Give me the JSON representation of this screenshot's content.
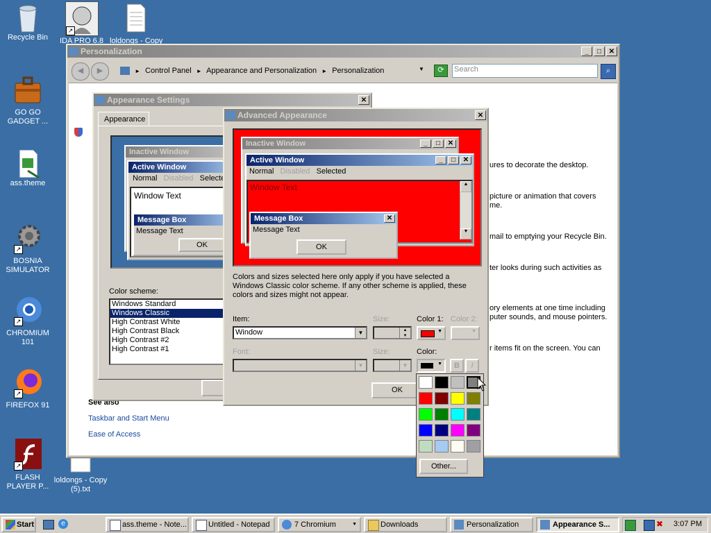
{
  "desktop": {
    "icons": [
      {
        "label": "Recycle Bin"
      },
      {
        "label": "IDA PRO 6.8"
      },
      {
        "label": "loldongs - Copy"
      },
      {
        "label": "GO GO GADGET ..."
      },
      {
        "label": "ass.theme"
      },
      {
        "label": "BOSNIA SIMULATOR"
      },
      {
        "label": "CHROMIUM 101"
      },
      {
        "label": "FIREFOX 91"
      },
      {
        "label": "FLASH PLAYER P..."
      },
      {
        "label": "loldongs - Copy (5).txt"
      }
    ]
  },
  "personalization": {
    "title": "Personalization",
    "breadcrumb": [
      "Control Panel",
      "Appearance and Personalization",
      "Personalization"
    ],
    "search_placeholder": "Search",
    "body_lines": [
      "ures to decorate the desktop.",
      "picture or animation that covers",
      "me.",
      "mail to emptying your Recycle Bin.",
      "ter looks during such activities as",
      "ory elements at one time including",
      "puter sounds, and mouse pointers.",
      "r items fit on the screen. You can"
    ],
    "see_also": "See also",
    "links": [
      "Taskbar and Start Menu",
      "Ease of Access"
    ]
  },
  "appearance_settings": {
    "title": "Appearance Settings",
    "tab": "Appearance",
    "preview": {
      "inactive_title": "Inactive Window",
      "active_title": "Active Window",
      "menu": [
        "Normal",
        "Disabled",
        "Selected"
      ],
      "window_text": "Window Text",
      "msgbox_title": "Message Box",
      "msgbox_text": "Message Text",
      "ok": "OK"
    },
    "color_scheme_label": "Color scheme:",
    "schemes": [
      "Windows Standard",
      "Windows Classic",
      "High Contrast White",
      "High Contrast Black",
      "High Contrast #2",
      "High Contrast #1"
    ],
    "selected_scheme": "Windows Classic"
  },
  "advanced_appearance": {
    "title": "Advanced Appearance",
    "preview": {
      "inactive_title": "Inactive Window",
      "active_title": "Active Window",
      "menu": [
        "Normal",
        "Disabled",
        "Selected"
      ],
      "window_text": "Window Text",
      "msgbox_title": "Message Box",
      "msgbox_text": "Message Text",
      "ok": "OK"
    },
    "note": "Colors and sizes selected here only apply if you have selected a Windows Classic color scheme. If any other scheme is applied, these colors and sizes might not appear.",
    "item_label": "Item:",
    "item_value": "Window",
    "size_label": "Size:",
    "color1_label": "Color 1:",
    "color2_label": "Color 2:",
    "font_label": "Font:",
    "font_size_label": "Size:",
    "color_label": "Color:",
    "bold_label": "B",
    "italic_label": "I",
    "ok": "OK",
    "preview_bg": "#ff0000"
  },
  "color_picker": {
    "colors": [
      "#ffffff",
      "#000000",
      "#c0c0c0",
      "#808080",
      "#ff0000",
      "#800000",
      "#ffff00",
      "#808000",
      "#00ff00",
      "#008000",
      "#00ffff",
      "#008080",
      "#0000ff",
      "#000080",
      "#ff00ff",
      "#800080",
      "#c0dcc0",
      "#a6caf0",
      "#fffbf0",
      "#a0a0a4"
    ],
    "other_label": "Other..."
  },
  "taskbar": {
    "start": "Start",
    "buttons": [
      "ass.theme - Note...",
      "Untitled - Notepad",
      "7 Chromium",
      "Downloads",
      "Personalization",
      "Appearance S..."
    ],
    "clock": "3:07 PM"
  }
}
